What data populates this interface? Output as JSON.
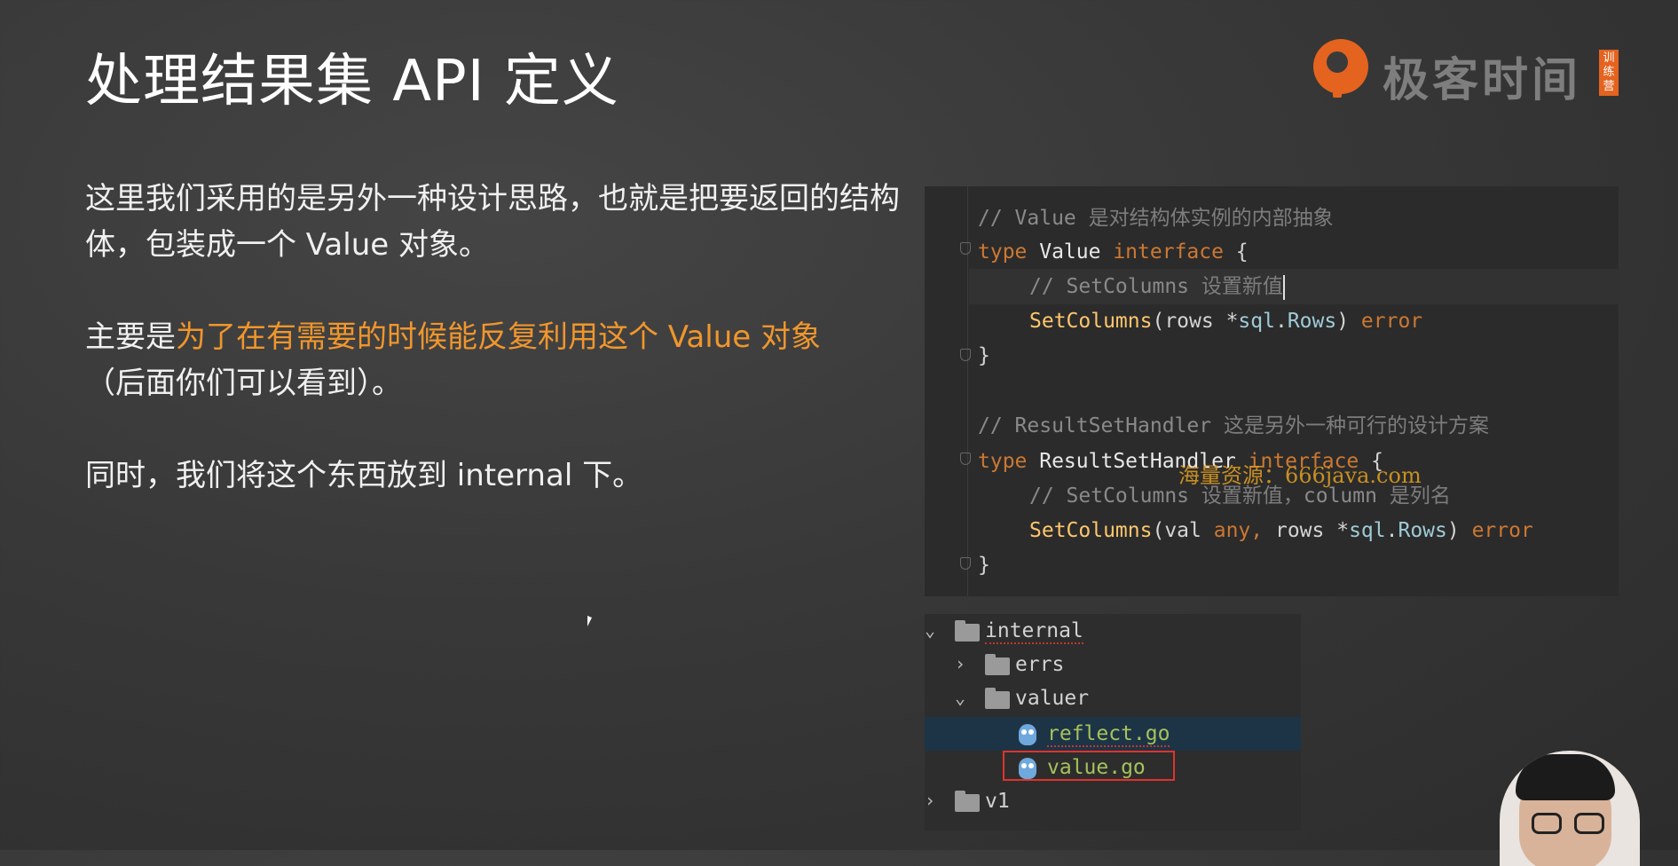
{
  "slide": {
    "title": "处理结果集 API 定义",
    "paragraph1": "这里我们采用的是另外一种设计思路，也就是把要返回的结构体，包装成一个 Value 对象。",
    "paragraph2_lead": "主要是",
    "paragraph2_highlight": "为了在有需要的时候能反复利用这个 Value 对象",
    "paragraph2_tail": "（后面你们可以看到）。",
    "paragraph3": "同时，我们将这个东西放到 internal 下。"
  },
  "logo": {
    "brand_text": "极客时间",
    "badge_text": "训练营"
  },
  "code": {
    "l1_comment_slash": "// Value ",
    "l1_comment_zh": "是对结构体实例的内部抽象",
    "l2_kw": "type",
    "l2_name": " Value ",
    "l2_kw2": "interface",
    "l2_brace": " {",
    "l3_comment_slash": "// SetColumns ",
    "l3_comment_zh": "设置新值",
    "l4_fn": "SetColumns",
    "l4_open": "(rows *",
    "l4_pkg": "sql",
    "l4_dot": ".",
    "l4_type": "Rows",
    "l4_close": ") ",
    "l4_err": "error",
    "l5_close": "}",
    "l7_comment_slash": "// ResultSetHandler ",
    "l7_comment_zh": "这是另外一种可行的设计方案",
    "l8_kw": "type",
    "l8_name": " ResultSetHandler ",
    "l8_kw2": "interface",
    "l8_brace": " {",
    "l9_comment_slash": "// SetColumns ",
    "l9_comment_zh": "设置新值，",
    "l9_comment_col": "column ",
    "l9_comment_zh2": "是列名",
    "l10_fn": "SetColumns",
    "l10_open": "(val ",
    "l10_any": "any,",
    "l10_rows": " rows *",
    "l10_pkg": "sql",
    "l10_dot": ".",
    "l10_type": "Rows",
    "l10_close": ") ",
    "l10_err": "error",
    "l11_close": "}"
  },
  "watermark": "海量资源：666java.com",
  "file_tree": {
    "internal": "internal",
    "errs": "errs",
    "valuer": "valuer",
    "reflect_go": "reflect.go",
    "value_go": "value.go",
    "v1": "v1",
    "chevron_open": "⌄",
    "chevron_closed": "›"
  },
  "colors": {
    "highlight": "#f0962c",
    "keyword": "#cc7832",
    "function": "#ffc66d",
    "selection": "#1d3447",
    "red_box": "#e0332b",
    "brand": "#e4631f"
  }
}
